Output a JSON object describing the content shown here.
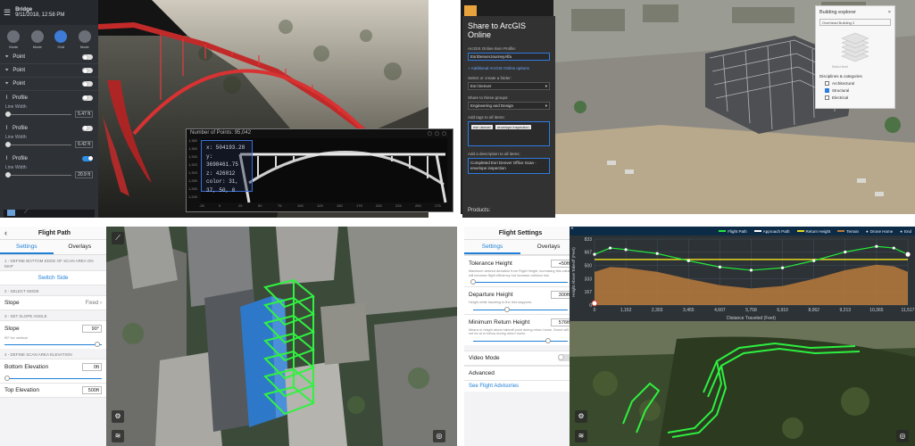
{
  "panel_a": {
    "app_title": "Bridge",
    "timestamp": "9/11/2018, 12:58 PM",
    "modes": [
      "Mode",
      "Mode",
      "Grid",
      "Mode"
    ],
    "layers": [
      {
        "label": "Point",
        "on": false
      },
      {
        "label": "Point",
        "on": false
      },
      {
        "label": "Point",
        "on": false
      }
    ],
    "profiles": [
      {
        "label": "Profile",
        "sub": "Line Width",
        "value": "5.47 ft",
        "on": false
      },
      {
        "label": "Profile",
        "sub": "Line Width",
        "value": "6.42 ft",
        "on": false
      },
      {
        "label": "Profile",
        "sub": "Line Width",
        "value": "20.9 ft",
        "on": true
      }
    ],
    "popup": {
      "title": "Number of Points: 95,042",
      "stats": [
        "x: 504193.28",
        "y: 3698461.75",
        "z: 426012",
        "color: 31, 37, 50, 0"
      ],
      "y_ticks": [
        "1,380",
        "1,360",
        "1,340",
        "1,320",
        "1,300",
        "1,280",
        "1,260",
        "1,240"
      ],
      "x_ticks": [
        "-25",
        "0",
        "25",
        "50",
        "75",
        "100",
        "125",
        "150",
        "175",
        "200",
        "225",
        "250",
        "275"
      ]
    }
  },
  "panel_b": {
    "share": {
      "title": "Share to ArcGIS Online",
      "profile_label": "ArcGIS Online Item Profile:",
      "profile_value": "EsriDenverJourneyAlfa",
      "add_link": "+ Additional ArcGIS Online options",
      "folder_label": "Select or create a folder:",
      "folder_value": "Esri Denver",
      "groups_label": "Share to these groups:",
      "groups_value": "Engineering and Design",
      "tags_label": "Add tags to all items:",
      "tags": [
        "esri denver",
        "envelope inspection"
      ],
      "desc_label": "Add a description to all items:",
      "desc_value": "Completed Esri Denver Office Scan - envelope inspection",
      "footer": "Products:"
    },
    "explorer": {
      "title": "Building explorer",
      "select_value": "Overhead Building 2",
      "select_level": "Select level",
      "section": "Disciplines & categories",
      "items": [
        {
          "label": "Architectural",
          "checked": false
        },
        {
          "label": "Structural",
          "checked": true
        },
        {
          "label": "Electrical",
          "checked": false
        }
      ]
    }
  },
  "panel_c": {
    "title": "Flight Path",
    "tabs": [
      "Settings",
      "Overlays"
    ],
    "s1": "1 - DEFINE BOTTOM EDGE OF SCAN AREA ON MAP",
    "switch_side": "Switch Side",
    "s2": "2 - SELECT MODE",
    "slope_label": "Slope",
    "slope_value": "Fixed",
    "s3": "3 - SET SLOPE ANGLE",
    "slope_angle_label": "Slope",
    "slope_angle_value": "90°",
    "slope_note": "90° for vertical",
    "s4": "4 - DEFINE SCAN AREA ELEVATION",
    "bottom_label": "Bottom Elevation",
    "bottom_value": "0ft",
    "top_label": "Top Elevation",
    "top_value": "500ft"
  },
  "panel_d": {
    "title": "Flight Settings",
    "tabs": [
      "Settings",
      "Overlays"
    ],
    "fields": [
      {
        "label": "Tolerance Height",
        "value": "+50ft",
        "desc": "Maximum desired deviation from Flight Height, increasing this value will increase flight efficiency but increase collision risk."
      },
      {
        "label": "Departure Height",
        "value": "300ft",
        "desc": "Height while traveling to the first waypoint."
      },
      {
        "label": "Minimum Return Height",
        "value": "576ft",
        "desc": "Means in height above takeoff point during return home. Drone will not be at or below during return home."
      }
    ],
    "video_mode": "Video Mode",
    "advanced": "Advanced",
    "see_advisories": "See Flight Advisories",
    "legend": [
      "Flight Path",
      "Approach Path",
      "Return Height",
      "Terrain",
      "Drone Home",
      "End"
    ],
    "colors": {
      "flight": "#25e83a",
      "approach": "#ffffff",
      "return": "#e8d81f",
      "terrain": "#b97a3c"
    }
  },
  "chart_data": {
    "type": "line",
    "title": "",
    "xlabel": "Distance Traveled (Feet)",
    "ylabel": "Height Above Takeoff (Feet)",
    "x_ticks": [
      "0",
      "1,152",
      "2,303",
      "3,455",
      "4,607",
      "5,758",
      "6,910",
      "8,062",
      "9,213",
      "10,365",
      "11,517"
    ],
    "y_ticks": [
      "833",
      "667",
      "500",
      "333",
      "167",
      "0"
    ],
    "ylim": [
      0,
      833
    ],
    "xlim": [
      0,
      11517
    ],
    "series": [
      {
        "name": "Flight Path",
        "x": [
          0,
          576,
          1152,
          2303,
          3455,
          4607,
          5758,
          6910,
          8062,
          9213,
          10365,
          11000,
          11517
        ],
        "values": [
          640,
          720,
          700,
          650,
          560,
          480,
          440,
          470,
          560,
          670,
          740,
          720,
          640
        ]
      },
      {
        "name": "Return Height",
        "x": [
          0,
          11517
        ],
        "values": [
          576,
          576
        ]
      },
      {
        "name": "Terrain",
        "x": [
          0,
          576,
          1152,
          2303,
          3455,
          4607,
          5758,
          6910,
          8062,
          9213,
          10365,
          11000,
          11517
        ],
        "values": [
          420,
          480,
          470,
          420,
          330,
          250,
          210,
          240,
          330,
          440,
          510,
          490,
          420
        ]
      }
    ]
  }
}
